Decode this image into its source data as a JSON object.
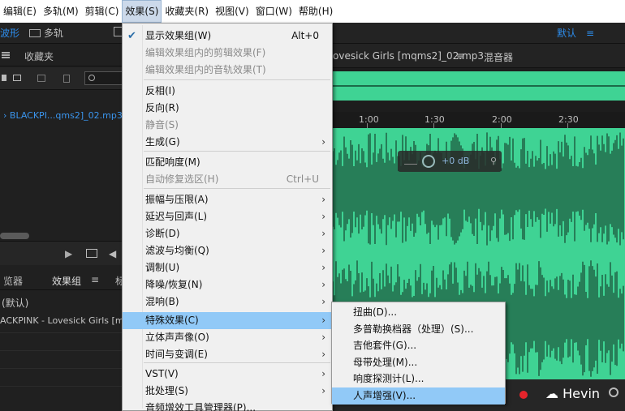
{
  "menubar": {
    "items": [
      "编辑(E)",
      "多轨(M)",
      "剪辑(C)",
      "效果(S)",
      "收藏夹(R)",
      "视图(V)",
      "窗口(W)",
      "帮助(H)"
    ],
    "active_index": 3
  },
  "toolbar": {
    "waveform_label": "波形",
    "multitrack_label": "多轨",
    "workspace_label": "默认"
  },
  "left_panel": {
    "favorites_title": "收藏夹",
    "file_name": "BLACKPI...qms2]_02.mp3",
    "tabs": [
      "览器",
      "效果组",
      "标"
    ],
    "preset": "(默认)",
    "rack_item": "ACKPINK - Lovesick Girls [mq"
  },
  "editor": {
    "file_tab": "ovesick Girls [mqms2]_02.mp3",
    "mixer_tab": "混音器",
    "ruler_marks": [
      "1:00",
      "1:30",
      "2:00",
      "2:30"
    ],
    "hud_gain": "+0 dB",
    "watermark": "Hevin"
  },
  "effects_menu": {
    "items": [
      {
        "label": "显示效果组(W)",
        "shortcut": "Alt+0",
        "checked": true
      },
      {
        "label": "编辑效果组内的剪辑效果(F)",
        "disabled": true
      },
      {
        "label": "编辑效果组内的音轨效果(T)",
        "disabled": true
      },
      {
        "label": "反相(I)"
      },
      {
        "label": "反向(R)"
      },
      {
        "label": "静音(S)",
        "disabled": true
      },
      {
        "label": "生成(G)",
        "submenu": true
      },
      {
        "label": "匹配响度(M)"
      },
      {
        "label": "自动修复选区(H)",
        "shortcut": "Ctrl+U",
        "disabled": true
      },
      {
        "label": "振幅与压限(A)",
        "submenu": true
      },
      {
        "label": "延迟与回声(L)",
        "submenu": true
      },
      {
        "label": "诊断(D)",
        "submenu": true
      },
      {
        "label": "滤波与均衡(Q)",
        "submenu": true
      },
      {
        "label": "调制(U)",
        "submenu": true
      },
      {
        "label": "降噪/恢复(N)",
        "submenu": true
      },
      {
        "label": "混响(B)",
        "submenu": true
      },
      {
        "label": "特殊效果(C)",
        "submenu": true,
        "highlighted": true
      },
      {
        "label": "立体声声像(O)",
        "submenu": true
      },
      {
        "label": "时间与变调(E)",
        "submenu": true
      },
      {
        "label": "VST(V)",
        "submenu": true
      },
      {
        "label": "批处理(S)",
        "submenu": true
      },
      {
        "label": "音频增效工具管理器(P)..."
      }
    ]
  },
  "special_effects_submenu": {
    "items": [
      {
        "label": "扭曲(D)..."
      },
      {
        "label": "多普勒换档器（处理）(S)..."
      },
      {
        "label": "吉他套件(G)..."
      },
      {
        "label": "母带处理(M)..."
      },
      {
        "label": "响度探测计(L)..."
      },
      {
        "label": "人声增强(V)...",
        "highlighted": true
      }
    ]
  },
  "colors": {
    "waveform": "#3fd394",
    "menu_highlight": "#91c9f7",
    "accent_blue": "#2d8ceb"
  }
}
